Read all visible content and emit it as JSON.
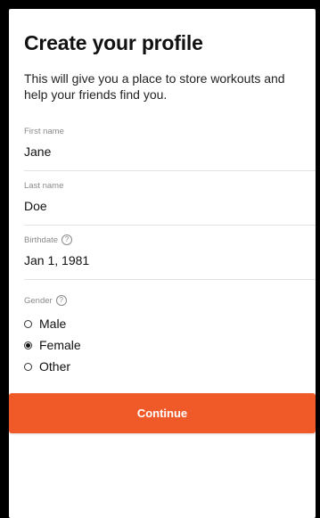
{
  "header": {
    "title": "Create your profile",
    "subtitle": "This will give you a place to store workouts and help your friends find you."
  },
  "fields": {
    "first_name": {
      "label": "First name",
      "value": "Jane"
    },
    "last_name": {
      "label": "Last name",
      "value": "Doe"
    },
    "birthdate": {
      "label": "Birthdate",
      "value": "Jan 1, 1981",
      "help_glyph": "?"
    }
  },
  "gender": {
    "label": "Gender",
    "help_glyph": "?",
    "options": [
      {
        "label": "Male",
        "selected": false
      },
      {
        "label": "Female",
        "selected": true
      },
      {
        "label": "Other",
        "selected": false
      }
    ]
  },
  "actions": {
    "continue_label": "Continue"
  },
  "colors": {
    "accent": "#f05a28",
    "background": "#ffffff",
    "frame": "#000000"
  }
}
